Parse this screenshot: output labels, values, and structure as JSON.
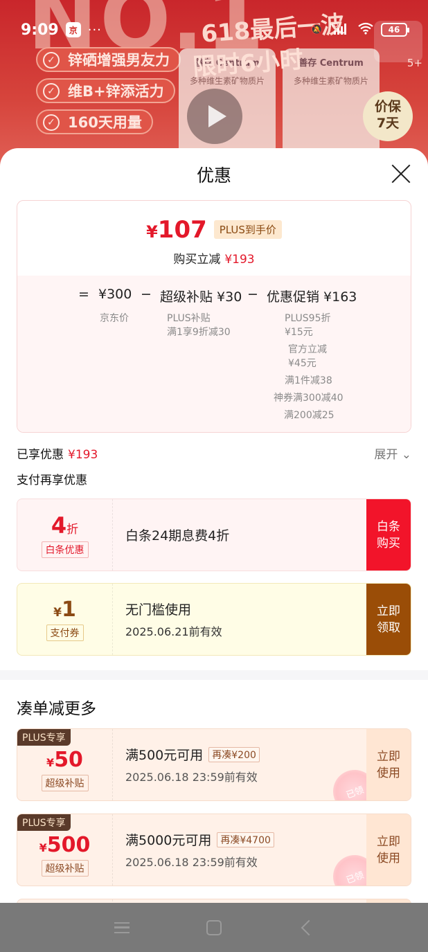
{
  "background": {
    "big_text": "NO.1",
    "benefits": [
      "锌硒增强男友力",
      "维B+锌添活力",
      "160天用量"
    ],
    "promo_line1": "618最后一波",
    "promo_line2": "限时6小时",
    "brand": "善存 Centrum",
    "product_label": "多种维生素矿物质片",
    "price_guard": [
      "价保",
      "7天"
    ],
    "badge_count": "5+"
  },
  "status_bar": {
    "time": "9:09",
    "app_icon": "jd-app-icon",
    "dots": "···",
    "network": "HD",
    "battery": "46"
  },
  "sheet": {
    "title": "优惠",
    "card": {
      "currency": "¥",
      "price": "107",
      "price_tag": "PLUS到手价",
      "subtitle_label": "购买立减",
      "subtitle_amount": "¥193",
      "calc": {
        "equals": "=",
        "jd_price": "¥300",
        "minus1": "−",
        "super_subsidy": "超级补贴 ¥30",
        "minus2": "−",
        "promo": "优惠促销 ¥163",
        "jd_price_label": "京东价",
        "plus_subsidy_label": "PLUS补贴",
        "plus_subsidy_detail": "满1享9折减30",
        "promo_items": [
          "PLUS95折",
          "¥15元",
          "官方立减",
          "¥45元",
          "满1件减38",
          "神券满300减40",
          "满200减25"
        ]
      }
    },
    "enjoyed_label": "已享优惠",
    "enjoyed_amount": "¥193",
    "expand_label": "展开 ⌄",
    "pay_more_label": "支付再享优惠",
    "coupons": {
      "baitiao": {
        "big": "4",
        "unit": "折",
        "tag": "白条优惠",
        "title": "白条24期息费4折",
        "action": "白条\n购买"
      },
      "pay": {
        "currency": "¥",
        "big": "1",
        "tag": "支付券",
        "title": "无门槛使用",
        "expiry": "2025.06.21前有效",
        "action": "立即\n领取"
      }
    },
    "more_title": "凑单减更多",
    "plus_coupons": [
      {
        "flag": "PLUS专享",
        "currency": "¥",
        "big": "50",
        "tag": "超级补贴",
        "title": "满500元可用",
        "extra": "再凑¥200",
        "expiry": "2025.06.18 23:59前有效",
        "action": "立即\n使用",
        "stamp": "已领"
      },
      {
        "flag": "PLUS专享",
        "currency": "¥",
        "big": "500",
        "tag": "超级补贴",
        "title": "满5000元可用",
        "extra": "再凑¥4700",
        "expiry": "2025.06.18 23:59前有效",
        "action": "立即\n使用",
        "stamp": "已领"
      }
    ]
  },
  "nav": {
    "menu": "menu-icon",
    "home": "home-icon",
    "back": "back-icon"
  }
}
